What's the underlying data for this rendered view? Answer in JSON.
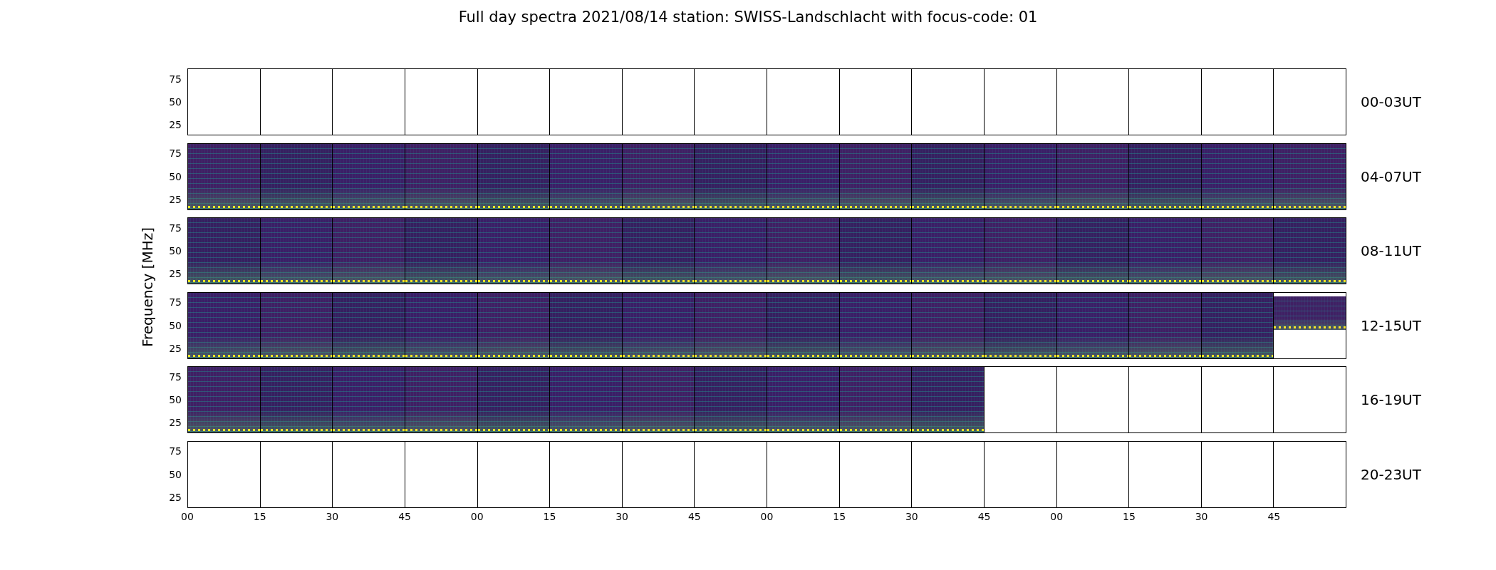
{
  "title": "Full day spectra 2021/08/14 station: SWISS-Landschlacht with focus-code: 01",
  "ylabel": "Frequency [MHz]",
  "rows": [
    {
      "label": "00-03UT",
      "yticks": [
        "75",
        "50",
        "25"
      ],
      "panels": [
        {
          "kind": "empty"
        },
        {
          "kind": "empty"
        },
        {
          "kind": "empty"
        },
        {
          "kind": "empty"
        },
        {
          "kind": "empty"
        },
        {
          "kind": "empty"
        },
        {
          "kind": "empty"
        },
        {
          "kind": "empty"
        },
        {
          "kind": "empty"
        },
        {
          "kind": "empty"
        },
        {
          "kind": "empty"
        },
        {
          "kind": "empty"
        },
        {
          "kind": "empty"
        },
        {
          "kind": "empty"
        },
        {
          "kind": "empty"
        },
        {
          "kind": "empty"
        }
      ]
    },
    {
      "label": "04-07UT",
      "yticks": [
        "75",
        "50",
        "25"
      ],
      "panels": [
        {
          "kind": "spectrogram"
        },
        {
          "kind": "spectrogram"
        },
        {
          "kind": "spectrogram"
        },
        {
          "kind": "spectrogram"
        },
        {
          "kind": "spectrogram"
        },
        {
          "kind": "spectrogram"
        },
        {
          "kind": "spectrogram"
        },
        {
          "kind": "spectrogram"
        },
        {
          "kind": "spectrogram"
        },
        {
          "kind": "spectrogram"
        },
        {
          "kind": "spectrogram"
        },
        {
          "kind": "spectrogram"
        },
        {
          "kind": "spectrogram"
        },
        {
          "kind": "spectrogram"
        },
        {
          "kind": "spectrogram"
        },
        {
          "kind": "spectrogram"
        }
      ]
    },
    {
      "label": "08-11UT",
      "yticks": [
        "75",
        "50",
        "25"
      ],
      "panels": [
        {
          "kind": "spectrogram"
        },
        {
          "kind": "spectrogram"
        },
        {
          "kind": "spectrogram"
        },
        {
          "kind": "spectrogram"
        },
        {
          "kind": "spectrogram"
        },
        {
          "kind": "spectrogram"
        },
        {
          "kind": "spectrogram"
        },
        {
          "kind": "spectrogram"
        },
        {
          "kind": "spectrogram"
        },
        {
          "kind": "spectrogram"
        },
        {
          "kind": "spectrogram"
        },
        {
          "kind": "spectrogram"
        },
        {
          "kind": "spectrogram"
        },
        {
          "kind": "spectrogram"
        },
        {
          "kind": "spectrogram"
        },
        {
          "kind": "spectrogram"
        }
      ]
    },
    {
      "label": "12-15UT",
      "yticks": [
        "75",
        "50",
        "25"
      ],
      "panels": [
        {
          "kind": "spectrogram"
        },
        {
          "kind": "spectrogram"
        },
        {
          "kind": "spectrogram"
        },
        {
          "kind": "spectrogram"
        },
        {
          "kind": "spectrogram"
        },
        {
          "kind": "spectrogram"
        },
        {
          "kind": "spectrogram"
        },
        {
          "kind": "spectrogram"
        },
        {
          "kind": "spectrogram"
        },
        {
          "kind": "spectrogram"
        },
        {
          "kind": "spectrogram"
        },
        {
          "kind": "spectrogram"
        },
        {
          "kind": "spectrogram"
        },
        {
          "kind": "spectrogram"
        },
        {
          "kind": "spectrogram"
        },
        {
          "kind": "partial"
        }
      ]
    },
    {
      "label": "16-19UT",
      "yticks": [
        "75",
        "50",
        "25"
      ],
      "panels": [
        {
          "kind": "spectrogram"
        },
        {
          "kind": "spectrogram"
        },
        {
          "kind": "spectrogram"
        },
        {
          "kind": "spectrogram"
        },
        {
          "kind": "spectrogram"
        },
        {
          "kind": "spectrogram"
        },
        {
          "kind": "spectrogram"
        },
        {
          "kind": "spectrogram"
        },
        {
          "kind": "spectrogram"
        },
        {
          "kind": "spectrogram"
        },
        {
          "kind": "spectrogram"
        },
        {
          "kind": "empty"
        },
        {
          "kind": "empty"
        },
        {
          "kind": "empty"
        },
        {
          "kind": "empty"
        },
        {
          "kind": "empty"
        }
      ]
    },
    {
      "label": "20-23UT",
      "yticks": [
        "75",
        "50",
        "25"
      ],
      "panels": [
        {
          "kind": "empty"
        },
        {
          "kind": "empty"
        },
        {
          "kind": "empty"
        },
        {
          "kind": "empty"
        },
        {
          "kind": "empty"
        },
        {
          "kind": "empty"
        },
        {
          "kind": "empty"
        },
        {
          "kind": "empty"
        },
        {
          "kind": "empty"
        },
        {
          "kind": "empty"
        },
        {
          "kind": "empty"
        },
        {
          "kind": "empty"
        },
        {
          "kind": "empty"
        },
        {
          "kind": "empty"
        },
        {
          "kind": "empty"
        },
        {
          "kind": "empty"
        }
      ]
    }
  ],
  "xticks": [
    "00",
    "15",
    "30",
    "45",
    "00",
    "15",
    "30",
    "45",
    "00",
    "15",
    "30",
    "45",
    "00",
    "15",
    "30",
    "45"
  ]
}
